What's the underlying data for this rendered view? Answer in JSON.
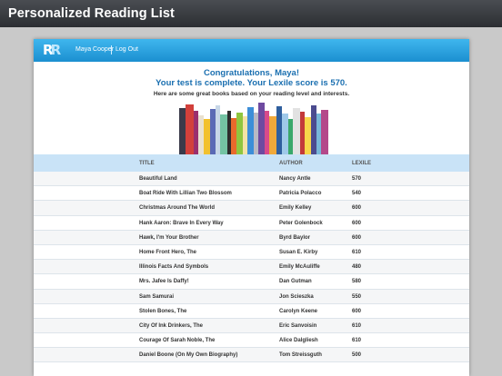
{
  "page": {
    "title": "Personalized Reading List"
  },
  "header": {
    "user_name": "Maya Cooper",
    "logout_label": "Log Out",
    "logo_text": "R"
  },
  "message": {
    "line1": "Congratulations, Maya!",
    "line2": "Your test is complete. Your Lexile score is 570.",
    "subline": "Here are some great books based on your reading level and interests."
  },
  "table": {
    "columns": {
      "title": "TITLE",
      "author": "AUTHOR",
      "lexile": "LEXILE"
    },
    "rows": [
      {
        "title": "Beautiful Land",
        "author": "Nancy Antle",
        "lexile": "570"
      },
      {
        "title": "Boat Ride With Lillian Two Blossom",
        "author": "Patricia Polacco",
        "lexile": "540"
      },
      {
        "title": "Christmas Around The World",
        "author": "Emily Kelley",
        "lexile": "600"
      },
      {
        "title": "Hank Aaron: Brave In Every Way",
        "author": "Peter Golenbock",
        "lexile": "600"
      },
      {
        "title": "Hawk, I'm Your Brother",
        "author": "Byrd Baylor",
        "lexile": "600"
      },
      {
        "title": "Home Front Hero, The",
        "author": "Susan E. Kirby",
        "lexile": "610"
      },
      {
        "title": "Illinois Facts And Symbols",
        "author": "Emily McAuliffe",
        "lexile": "480"
      },
      {
        "title": "Mrs. Jafee Is Daffy!",
        "author": "Dan Gutman",
        "lexile": "580"
      },
      {
        "title": "Sam Samurai",
        "author": "Jon Scieszka",
        "lexile": "550"
      },
      {
        "title": "Stolen Bones, The",
        "author": "Carolyn Keene",
        "lexile": "600"
      },
      {
        "title": "City Of Ink Drinkers, The",
        "author": "Eric Sanvoisin",
        "lexile": "610"
      },
      {
        "title": "Courage Of Sarah Noble, The",
        "author": "Alice Dalgliesh",
        "lexile": "610"
      },
      {
        "title": "Daniel Boone (On My Own Biography)",
        "author": "Tom Streissguth",
        "lexile": "500"
      }
    ]
  },
  "colors": {
    "header_bar": "#2c2e32",
    "app_bar": "#1b8fd0",
    "heading_text": "#1a6fb0",
    "table_header": "#c9e3f7"
  }
}
